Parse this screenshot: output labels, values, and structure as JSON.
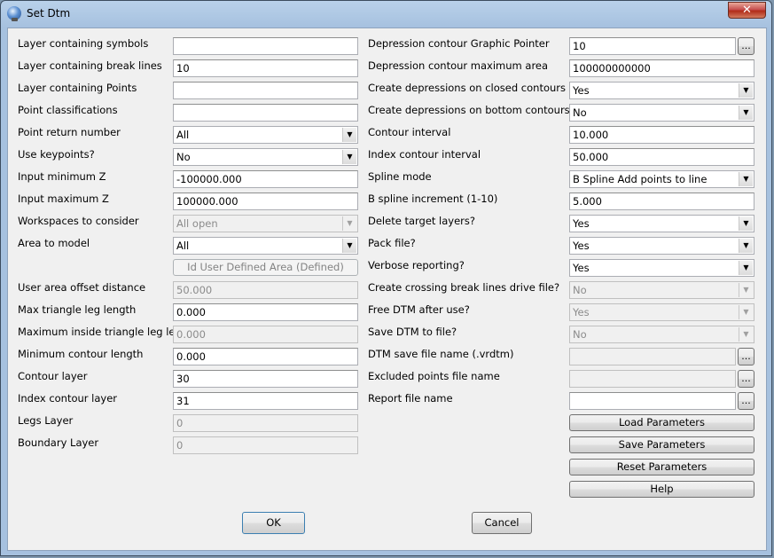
{
  "window": {
    "title": "Set Dtm",
    "close_glyph": "✕"
  },
  "left": {
    "layer_symbols": {
      "label": "Layer containing symbols",
      "value": ""
    },
    "layer_breaklines": {
      "label": "Layer containing break lines",
      "value": "10"
    },
    "layer_points": {
      "label": "Layer containing Points",
      "value": ""
    },
    "point_class": {
      "label": "Point classifications",
      "value": ""
    },
    "point_return": {
      "label": "Point return number",
      "value": "All"
    },
    "use_keypoints": {
      "label": "Use keypoints?",
      "value": "No"
    },
    "input_min_z": {
      "label": "Input minimum Z",
      "value": "-100000.000"
    },
    "input_max_z": {
      "label": "Input maximum Z",
      "value": "100000.000"
    },
    "workspaces": {
      "label": "Workspaces to consider",
      "value": "All open"
    },
    "area_to_model": {
      "label": "Area to model",
      "value": "All"
    },
    "id_user_area_button": "Id User Defined Area (Defined)",
    "user_area_offset": {
      "label": "User area offset distance",
      "value": "50.000"
    },
    "max_tri_leg": {
      "label": "Max triangle leg length",
      "value": "0.000"
    },
    "max_inside_leg": {
      "label": "Maximum inside triangle leg length",
      "value": "0.000"
    },
    "min_contour_len": {
      "label": "Minimum contour length",
      "value": "0.000"
    },
    "contour_layer": {
      "label": "Contour layer",
      "value": "30"
    },
    "index_contour_layer": {
      "label": "Index contour layer",
      "value": "31"
    },
    "legs_layer": {
      "label": "Legs Layer",
      "value": "0"
    },
    "boundary_layer": {
      "label": "Boundary Layer",
      "value": "0"
    }
  },
  "right": {
    "dep_graphic_ptr": {
      "label": "Depression contour Graphic Pointer",
      "value": "10"
    },
    "dep_max_area": {
      "label": "Depression contour maximum area",
      "value": "100000000000"
    },
    "dep_closed_only": {
      "label": "Create depressions on closed contours only?",
      "value": "Yes"
    },
    "dep_bottom_only": {
      "label": "Create depressions on bottom contours only?",
      "value": "No"
    },
    "contour_interval": {
      "label": "Contour interval",
      "value": "10.000"
    },
    "index_interval": {
      "label": "Index contour interval",
      "value": "50.000"
    },
    "spline_mode": {
      "label": "Spline mode",
      "value": "B Spline Add points to line"
    },
    "bspline_inc": {
      "label": "B spline increment (1-10)",
      "value": "5.000"
    },
    "delete_target": {
      "label": "Delete target layers?",
      "value": "Yes"
    },
    "pack_file": {
      "label": "Pack file?",
      "value": "Yes"
    },
    "verbose": {
      "label": "Verbose reporting?",
      "value": "Yes"
    },
    "crossing_drive": {
      "label": "Create crossing break lines drive file?",
      "value": "No"
    },
    "free_dtm": {
      "label": "Free DTM after use?",
      "value": "Yes"
    },
    "save_dtm": {
      "label": "Save DTM to file?",
      "value": "No"
    },
    "dtm_save_name": {
      "label": "DTM save file name (.vrdtm)",
      "value": ""
    },
    "excluded_points": {
      "label": "Excluded points file name",
      "value": ""
    },
    "report_file": {
      "label": "Report file name",
      "value": ""
    },
    "browse_label": "...",
    "load_params": "Load Parameters",
    "save_params": "Save Parameters",
    "reset_params": "Reset Parameters",
    "help": "Help"
  },
  "footer": {
    "ok": "OK",
    "cancel": "Cancel"
  },
  "icons": {
    "dropdown_arrow": "▼"
  }
}
